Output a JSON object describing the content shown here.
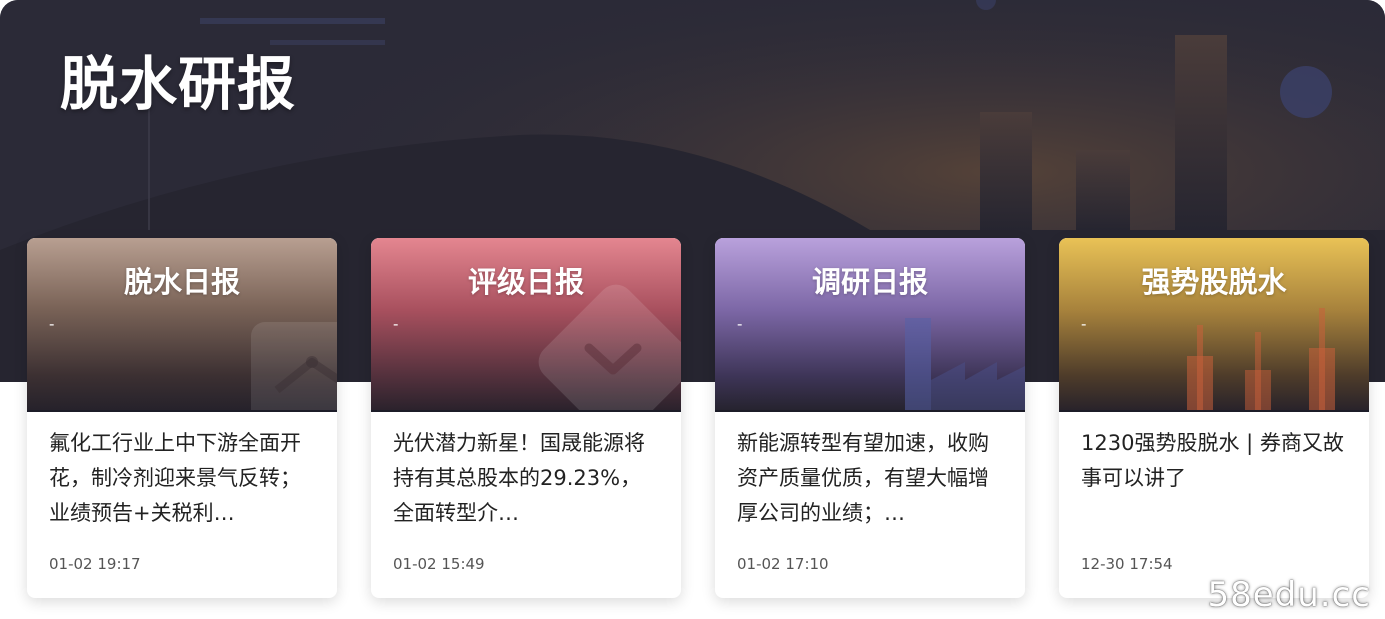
{
  "banner": {
    "title": "脱水研报"
  },
  "cards": [
    {
      "title": "脱水日报",
      "subtitle": "-",
      "headline": "氟化工行业上中下游全面开花，制冷剂迎来景气反转；业绩预告+关税利…",
      "time": "01-02 19:17",
      "icon": "line-chart-icon"
    },
    {
      "title": "评级日报",
      "subtitle": "-",
      "headline": "光伏潜力新星！国晟能源将持有其总股本的29.23%，全面转型介…",
      "time": "01-02 15:49",
      "icon": "rating-badge-icon"
    },
    {
      "title": "调研日报",
      "subtitle": "-",
      "headline": "新能源转型有望加速，收购资产质量优质，有望大幅增厚公司的业绩；…",
      "time": "01-02 17:10",
      "icon": "factory-icon"
    },
    {
      "title": "强势股脱水",
      "subtitle": "-",
      "headline": "1230强势股脱水 | 券商又故事可以讲了",
      "time": "12-30 17:54",
      "icon": "candlestick-icon"
    }
  ],
  "watermark": "58edu.cc",
  "colors": {
    "banner_bg": "#2a2a38",
    "card1_accent": "#b89f91",
    "card2_accent": "#e48690",
    "card3_accent": "#b9a1dc",
    "card4_accent": "#e9c256"
  }
}
